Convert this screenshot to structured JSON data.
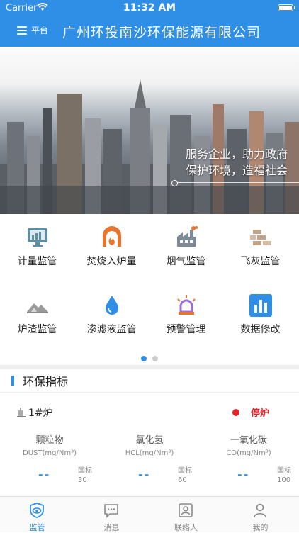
{
  "status_bar": {
    "carrier": "Carrier",
    "time": "11:32 AM"
  },
  "nav": {
    "menu_label": "平台",
    "title": "广州环投南沙环保能源有限公司"
  },
  "banner": {
    "slogan_line1": "服务企业，助力政府",
    "slogan_line2": "保护环境，造福社会"
  },
  "menu": {
    "items": [
      {
        "label": "计量监管",
        "icon": "monitor-chart-icon",
        "color": "#5a8fa8"
      },
      {
        "label": "焚烧入炉量",
        "icon": "furnace-fire-icon",
        "color": "#e8742e"
      },
      {
        "label": "烟气监管",
        "icon": "factory-smoke-icon",
        "color": "#7e8a96"
      },
      {
        "label": "飞灰监管",
        "icon": "bricks-icon",
        "color": "#c0a488"
      },
      {
        "label": "炉渣监管",
        "icon": "slag-pile-icon",
        "color": "#8a8a8a"
      },
      {
        "label": "渗滤液监管",
        "icon": "water-drop-icon",
        "color": "#2f8fe6"
      },
      {
        "label": "预警管理",
        "icon": "alarm-light-icon",
        "color": "#a06cd5"
      },
      {
        "label": "数据修改",
        "icon": "bar-chart-icon",
        "color": "#2f8fe6"
      }
    ],
    "pages": 2,
    "current_page": 1
  },
  "env": {
    "section_title": "环保指标",
    "furnace_name": "1#炉",
    "status_text": "停炉",
    "status_color": "#e8222b",
    "metrics": [
      {
        "name": "颗粒物",
        "unit": "DUST(mg/Nm³)",
        "value": "--",
        "std_label": "国标",
        "std_value": "30"
      },
      {
        "name": "氯化氢",
        "unit": "HCL(mg/Nm³)",
        "value": "--",
        "std_label": "国标",
        "std_value": "60"
      },
      {
        "name": "一氧化碳",
        "unit": "CO(mg/Nm³)",
        "value": "--",
        "std_label": "国标",
        "std_value": "100"
      }
    ]
  },
  "tabs": [
    {
      "label": "监管",
      "icon": "eye-shield-icon",
      "active": true
    },
    {
      "label": "消息",
      "icon": "message-icon",
      "active": false
    },
    {
      "label": "联络人",
      "icon": "contact-card-icon",
      "active": false
    },
    {
      "label": "我的",
      "icon": "person-icon",
      "active": false
    }
  ],
  "colors": {
    "primary": "#2f8fe6",
    "alert": "#e8222b"
  }
}
